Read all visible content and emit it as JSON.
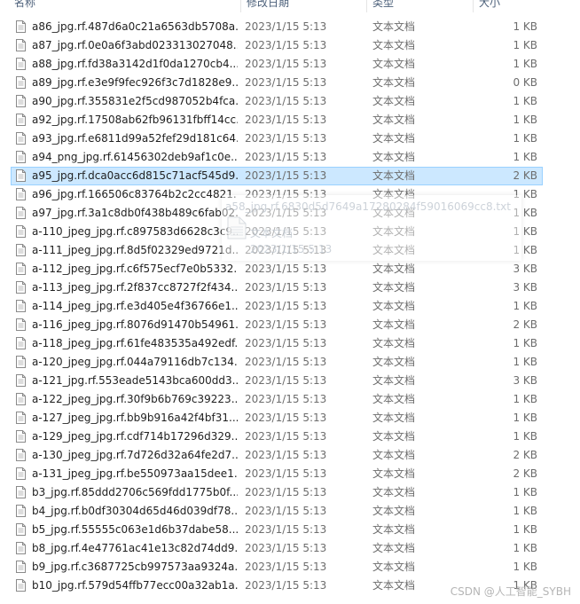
{
  "header": {
    "name": "名称",
    "date": "修改日期",
    "type": "类型",
    "size": "大小"
  },
  "files": [
    {
      "name": "a86_jpg.rf.487d6a0c21a6563db5708a...",
      "date": "2023/1/15 5:13",
      "type": "文本文档",
      "size": "1 KB"
    },
    {
      "name": "a87_jpg.rf.0e0a6f3abd023313027048...",
      "date": "2023/1/15 5:13",
      "type": "文本文档",
      "size": "1 KB"
    },
    {
      "name": "a88_jpg.rf.fd38a3142d1f0da1270cb4...",
      "date": "2023/1/15 5:13",
      "type": "文本文档",
      "size": "1 KB"
    },
    {
      "name": "a89_jpg.rf.e3e9f9fec926f3c7d1828e9...",
      "date": "2023/1/15 5:13",
      "type": "文本文档",
      "size": "0 KB"
    },
    {
      "name": "a90_jpg.rf.355831e2f5cd987052b4fca...",
      "date": "2023/1/15 5:13",
      "type": "文本文档",
      "size": "1 KB"
    },
    {
      "name": "a92_jpg.rf.17508ab62fb96131fbff14cc...",
      "date": "2023/1/15 5:13",
      "type": "文本文档",
      "size": "1 KB"
    },
    {
      "name": "a93_jpg.rf.e6811d99a52fef29d181c64...",
      "date": "2023/1/15 5:13",
      "type": "文本文档",
      "size": "1 KB"
    },
    {
      "name": "a94_png_jpg.rf.61456302deb9af1c0e...",
      "date": "2023/1/15 5:13",
      "type": "文本文档",
      "size": "1 KB"
    },
    {
      "name": "a95_jpg.rf.dca0acc6d815c71acf545d9...",
      "date": "2023/1/15 5:13",
      "type": "文本文档",
      "size": "2 KB",
      "selected": true
    },
    {
      "name": "a96_jpg.rf.166506c83764b2c2cc4821...",
      "date": "2023/1/15 5:13",
      "type": "文本文档",
      "size": "1 KB"
    },
    {
      "name": "a97_jpg.rf.3a1c8db0f438b489c6fab02...",
      "date": "2023/1/15 5:13",
      "type": "文本文档",
      "size": "1 KB"
    },
    {
      "name": "a-110_jpeg_jpg.rf.c897583d6628c3c9...",
      "date": "2023/1/15 5:13",
      "type": "文本文档",
      "size": "1 KB"
    },
    {
      "name": "a-111_jpeg_jpg.rf.8d5f02329ed9721d...",
      "date": "2023/1/15 5:13",
      "type": "文本文档",
      "size": "1 KB"
    },
    {
      "name": "a-112_jpeg_jpg.rf.c6f575ecf7e0b5332...",
      "date": "2023/1/15 5:13",
      "type": "文本文档",
      "size": "3 KB"
    },
    {
      "name": "a-113_jpeg_jpg.rf.2f837cc8727f2f434...",
      "date": "2023/1/15 5:13",
      "type": "文本文档",
      "size": "3 KB"
    },
    {
      "name": "a-114_jpeg_jpg.rf.e3d405e4f36766e1...",
      "date": "2023/1/15 5:13",
      "type": "文本文档",
      "size": "1 KB"
    },
    {
      "name": "a-116_jpeg_jpg.rf.8076d91470b54961...",
      "date": "2023/1/15 5:13",
      "type": "文本文档",
      "size": "2 KB"
    },
    {
      "name": "a-118_jpeg_jpg.rf.61fe483535a492edf...",
      "date": "2023/1/15 5:13",
      "type": "文本文档",
      "size": "1 KB"
    },
    {
      "name": "a-120_jpeg_jpg.rf.044a79116db7c134...",
      "date": "2023/1/15 5:13",
      "type": "文本文档",
      "size": "1 KB"
    },
    {
      "name": "a-121_jpg.rf.553eade5143bca600dd3...",
      "date": "2023/1/15 5:13",
      "type": "文本文档",
      "size": "3 KB"
    },
    {
      "name": "a-122_jpeg_jpg.rf.30f9b6b769c39223...",
      "date": "2023/1/15 5:13",
      "type": "文本文档",
      "size": "1 KB"
    },
    {
      "name": "a-127_jpeg_jpg.rf.bb9b916a42f4bf31...",
      "date": "2023/1/15 5:13",
      "type": "文本文档",
      "size": "1 KB"
    },
    {
      "name": "a-129_jpeg_jpg.rf.cdf714b17296d329...",
      "date": "2023/1/15 5:13",
      "type": "文本文档",
      "size": "1 KB"
    },
    {
      "name": "a-130_jpeg_jpg.rf.7d726d32a64fe2d7...",
      "date": "2023/1/15 5:13",
      "type": "文本文档",
      "size": "2 KB"
    },
    {
      "name": "a-131_jpeg_jpg.rf.be550973aa15dee1...",
      "date": "2023/1/15 5:13",
      "type": "文本文档",
      "size": "2 KB"
    },
    {
      "name": "b3_jpg.rf.85ddd2706c569fdd1775b0f...",
      "date": "2023/1/15 5:13",
      "type": "文本文档",
      "size": "1 KB"
    },
    {
      "name": "b4_jpg.rf.b0df30304d65d46d039df78...",
      "date": "2023/1/15 5:13",
      "type": "文本文档",
      "size": "1 KB"
    },
    {
      "name": "b5_jpg.rf.55555c063e1d6b37dabe58...",
      "date": "2023/1/15 5:13",
      "type": "文本文档",
      "size": "1 KB"
    },
    {
      "name": "b8_jpg.rf.4e47761ac41e13c82d74dd9...",
      "date": "2023/1/15 5:13",
      "type": "文本文档",
      "size": "1 KB"
    },
    {
      "name": "b9_jpg.rf.c3687725cb997573aa9324a...",
      "date": "2023/1/15 5:13",
      "type": "文本文档",
      "size": "1 KB"
    },
    {
      "name": "b10_jpg.rf.579d54ffb77ecc00a32ab1a...",
      "date": "2023/1/15 5:13",
      "type": "文本文档",
      "size": "1 KB"
    }
  ],
  "drag_ghost": {
    "name": "a58_jpg.rf.6830d5d7649a17280284f59016069cc8.txt",
    "type": "文本文档",
    "date": "2023/1/15 5:13"
  },
  "watermark": "CSDN @人工智能_SYBH",
  "icons": {
    "file": "text-file-icon"
  },
  "colors": {
    "selected_bg": "#cce8ff",
    "selected_border": "#99d1ff",
    "header_text": "#4c607a",
    "meta_text": "#6d6d6d"
  }
}
